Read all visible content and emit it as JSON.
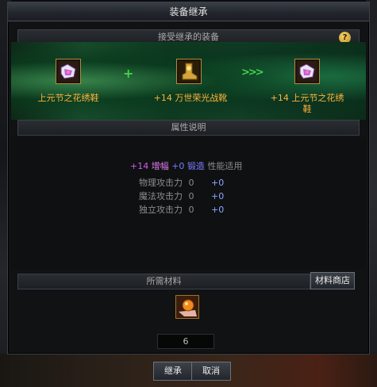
{
  "window": {
    "title": "装备继承",
    "close_label": "×"
  },
  "sections": {
    "receive_header": "接受继承的装备",
    "attr_header": "属性说明",
    "materials_header": "所需材料"
  },
  "help": {
    "label": "?"
  },
  "items": {
    "source": {
      "name": "上元节之花绣鞋",
      "icon": "embroidered-shoe-icon"
    },
    "consumed": {
      "enhance": "+14",
      "name": "万世荣光战靴",
      "icon": "golden-boot-icon"
    },
    "result": {
      "enhance": "+14",
      "name_line1": "上元节之花绣",
      "name_line2": "鞋",
      "icon": "embroidered-shoe-icon"
    }
  },
  "symbols": {
    "plus": "+",
    "arrows": ">>>"
  },
  "attributes": {
    "summary": {
      "amp_level": "+14",
      "amp_label": "增幅",
      "forge_level": "+0",
      "forge_label": "锻造",
      "applies_label": "性能适用"
    },
    "rows": [
      {
        "label": "物理攻击力",
        "base": "0",
        "bonus": "+0"
      },
      {
        "label": "魔法攻击力",
        "base": "0",
        "bonus": "+0"
      },
      {
        "label": "独立攻击力",
        "base": "0",
        "bonus": "+0"
      }
    ]
  },
  "materials": {
    "shop_button": "材料商店",
    "item_icon": "orb-material-icon",
    "count": "6"
  },
  "buttons": {
    "confirm": "继承",
    "cancel": "取消"
  },
  "colors": {
    "accent_gold": "#ffb33a",
    "amp_purple": "#cf5ee6",
    "forge_blue": "#7d7bff",
    "arrow_green": "#43d14a"
  }
}
